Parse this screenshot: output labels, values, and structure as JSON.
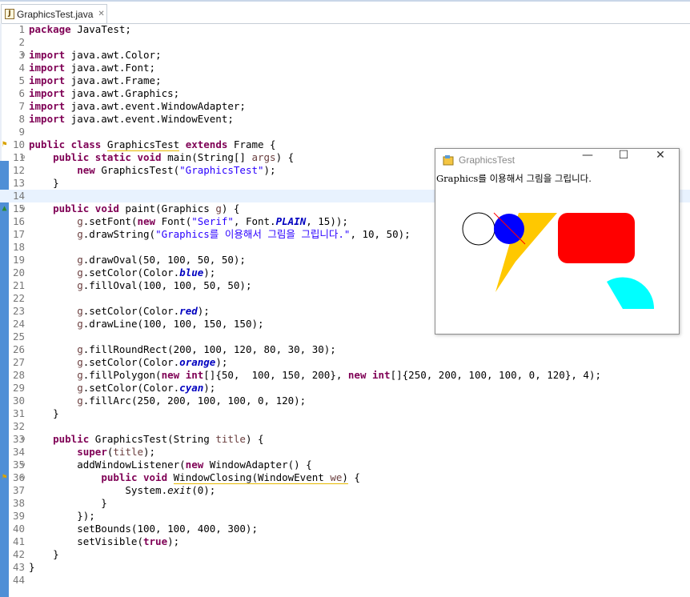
{
  "tab": {
    "filename": "GraphicsTest.java",
    "close_glyph": "✕",
    "icon": "java-file-icon"
  },
  "code_lines": [
    "1",
    "2",
    "3",
    "4",
    "5",
    "6",
    "7",
    "8",
    "9",
    "10",
    "11",
    "12",
    "13",
    "14",
    "15",
    "16",
    "17",
    "18",
    "19",
    "20",
    "21",
    "22",
    "23",
    "24",
    "25",
    "26",
    "27",
    "28",
    "29",
    "30",
    "31",
    "32",
    "33",
    "34",
    "35",
    "36",
    "37",
    "38",
    "39",
    "40",
    "41",
    "42",
    "43",
    "44"
  ],
  "window": {
    "title": "GraphicsTest",
    "minimize_glyph": "—",
    "maximize_glyph": "☐",
    "close_glyph": "✕",
    "drawn_text": "Graphics를 이용해서 그림을 그립니다.",
    "colors": {
      "blue": "#0000ff",
      "red": "#ff0000",
      "orange": "#ffc800",
      "cyan": "#00ffff"
    }
  }
}
